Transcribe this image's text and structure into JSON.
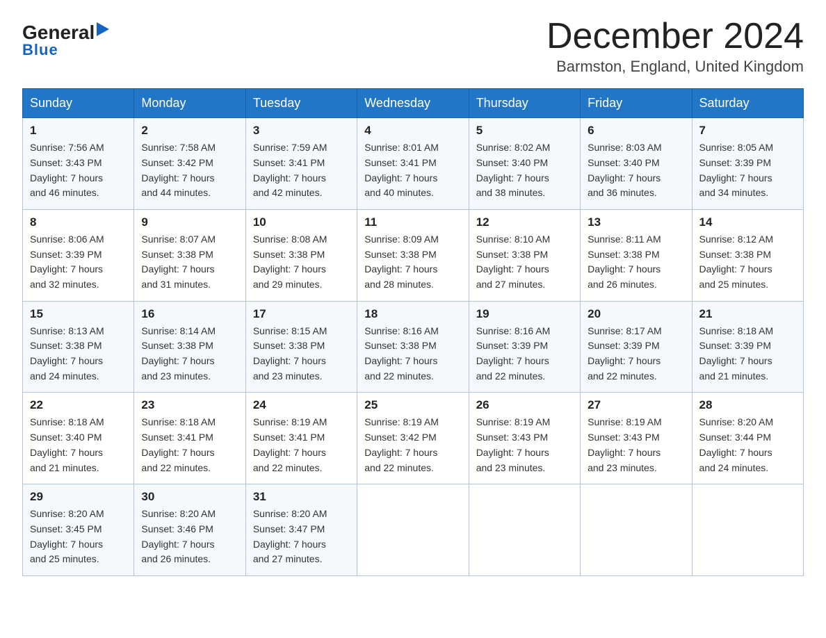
{
  "header": {
    "logo_general": "General",
    "logo_blue": "Blue",
    "month_title": "December 2024",
    "location": "Barmston, England, United Kingdom"
  },
  "weekdays": [
    "Sunday",
    "Monday",
    "Tuesday",
    "Wednesday",
    "Thursday",
    "Friday",
    "Saturday"
  ],
  "weeks": [
    [
      {
        "day": "1",
        "sunrise": "7:56 AM",
        "sunset": "3:43 PM",
        "daylight": "7 hours and 46 minutes."
      },
      {
        "day": "2",
        "sunrise": "7:58 AM",
        "sunset": "3:42 PM",
        "daylight": "7 hours and 44 minutes."
      },
      {
        "day": "3",
        "sunrise": "7:59 AM",
        "sunset": "3:41 PM",
        "daylight": "7 hours and 42 minutes."
      },
      {
        "day": "4",
        "sunrise": "8:01 AM",
        "sunset": "3:41 PM",
        "daylight": "7 hours and 40 minutes."
      },
      {
        "day": "5",
        "sunrise": "8:02 AM",
        "sunset": "3:40 PM",
        "daylight": "7 hours and 38 minutes."
      },
      {
        "day": "6",
        "sunrise": "8:03 AM",
        "sunset": "3:40 PM",
        "daylight": "7 hours and 36 minutes."
      },
      {
        "day": "7",
        "sunrise": "8:05 AM",
        "sunset": "3:39 PM",
        "daylight": "7 hours and 34 minutes."
      }
    ],
    [
      {
        "day": "8",
        "sunrise": "8:06 AM",
        "sunset": "3:39 PM",
        "daylight": "7 hours and 32 minutes."
      },
      {
        "day": "9",
        "sunrise": "8:07 AM",
        "sunset": "3:38 PM",
        "daylight": "7 hours and 31 minutes."
      },
      {
        "day": "10",
        "sunrise": "8:08 AM",
        "sunset": "3:38 PM",
        "daylight": "7 hours and 29 minutes."
      },
      {
        "day": "11",
        "sunrise": "8:09 AM",
        "sunset": "3:38 PM",
        "daylight": "7 hours and 28 minutes."
      },
      {
        "day": "12",
        "sunrise": "8:10 AM",
        "sunset": "3:38 PM",
        "daylight": "7 hours and 27 minutes."
      },
      {
        "day": "13",
        "sunrise": "8:11 AM",
        "sunset": "3:38 PM",
        "daylight": "7 hours and 26 minutes."
      },
      {
        "day": "14",
        "sunrise": "8:12 AM",
        "sunset": "3:38 PM",
        "daylight": "7 hours and 25 minutes."
      }
    ],
    [
      {
        "day": "15",
        "sunrise": "8:13 AM",
        "sunset": "3:38 PM",
        "daylight": "7 hours and 24 minutes."
      },
      {
        "day": "16",
        "sunrise": "8:14 AM",
        "sunset": "3:38 PM",
        "daylight": "7 hours and 23 minutes."
      },
      {
        "day": "17",
        "sunrise": "8:15 AM",
        "sunset": "3:38 PM",
        "daylight": "7 hours and 23 minutes."
      },
      {
        "day": "18",
        "sunrise": "8:16 AM",
        "sunset": "3:38 PM",
        "daylight": "7 hours and 22 minutes."
      },
      {
        "day": "19",
        "sunrise": "8:16 AM",
        "sunset": "3:39 PM",
        "daylight": "7 hours and 22 minutes."
      },
      {
        "day": "20",
        "sunrise": "8:17 AM",
        "sunset": "3:39 PM",
        "daylight": "7 hours and 22 minutes."
      },
      {
        "day": "21",
        "sunrise": "8:18 AM",
        "sunset": "3:39 PM",
        "daylight": "7 hours and 21 minutes."
      }
    ],
    [
      {
        "day": "22",
        "sunrise": "8:18 AM",
        "sunset": "3:40 PM",
        "daylight": "7 hours and 21 minutes."
      },
      {
        "day": "23",
        "sunrise": "8:18 AM",
        "sunset": "3:41 PM",
        "daylight": "7 hours and 22 minutes."
      },
      {
        "day": "24",
        "sunrise": "8:19 AM",
        "sunset": "3:41 PM",
        "daylight": "7 hours and 22 minutes."
      },
      {
        "day": "25",
        "sunrise": "8:19 AM",
        "sunset": "3:42 PM",
        "daylight": "7 hours and 22 minutes."
      },
      {
        "day": "26",
        "sunrise": "8:19 AM",
        "sunset": "3:43 PM",
        "daylight": "7 hours and 23 minutes."
      },
      {
        "day": "27",
        "sunrise": "8:19 AM",
        "sunset": "3:43 PM",
        "daylight": "7 hours and 23 minutes."
      },
      {
        "day": "28",
        "sunrise": "8:20 AM",
        "sunset": "3:44 PM",
        "daylight": "7 hours and 24 minutes."
      }
    ],
    [
      {
        "day": "29",
        "sunrise": "8:20 AM",
        "sunset": "3:45 PM",
        "daylight": "7 hours and 25 minutes."
      },
      {
        "day": "30",
        "sunrise": "8:20 AM",
        "sunset": "3:46 PM",
        "daylight": "7 hours and 26 minutes."
      },
      {
        "day": "31",
        "sunrise": "8:20 AM",
        "sunset": "3:47 PM",
        "daylight": "7 hours and 27 minutes."
      },
      null,
      null,
      null,
      null
    ]
  ]
}
